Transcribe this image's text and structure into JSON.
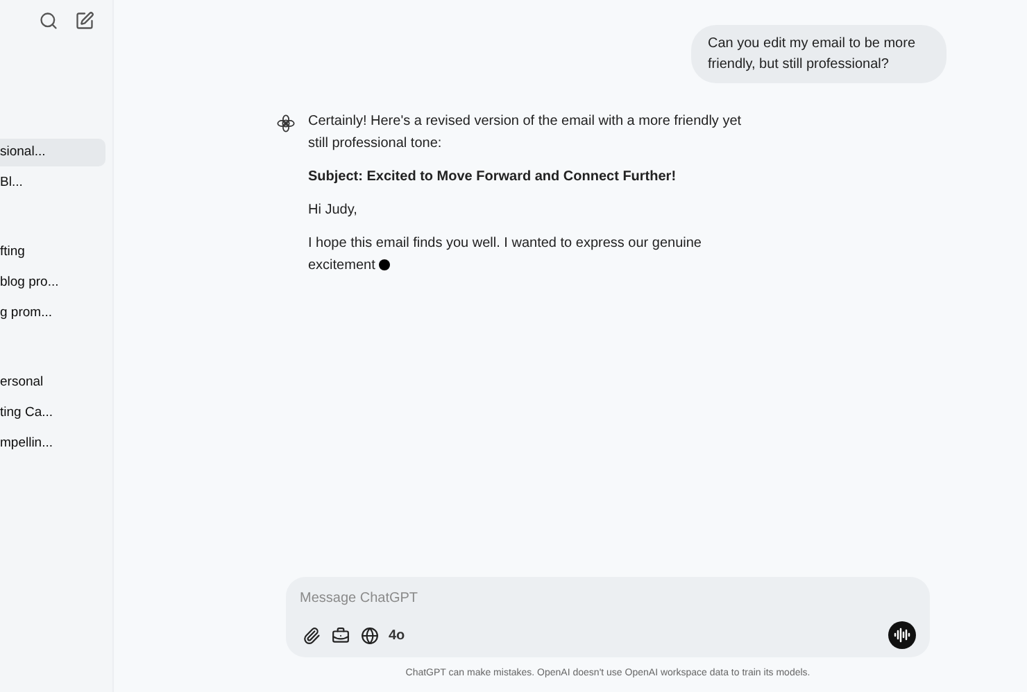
{
  "sidebar": {
    "items": [
      {
        "label": "sional...",
        "selected": true
      },
      {
        "label": "Bl...",
        "selected": false
      },
      {
        "label": "fting",
        "selected": false
      },
      {
        "label": "blog pro...",
        "selected": false
      },
      {
        "label": "g prom...",
        "selected": false
      },
      {
        "label": "ersonal",
        "selected": false
      },
      {
        "label": "ting Ca...",
        "selected": false
      },
      {
        "label": "mpellin...",
        "selected": false
      }
    ]
  },
  "user_message": "Can you edit my email to be more friendly, but still professional?",
  "assistant_message": {
    "paragraphs": [
      {
        "kind": "text",
        "text": "Certainly! Here's a revised version of the email with a more friendly yet still professional tone:"
      },
      {
        "kind": "bold",
        "text": "Subject: Excited to Move Forward and Connect Further!"
      },
      {
        "kind": "text",
        "text": "Hi Judy,"
      },
      {
        "kind": "streaming",
        "text": "I hope this email finds you well. I wanted to express our genuine excitement"
      }
    ]
  },
  "composer": {
    "placeholder": "Message ChatGPT",
    "model": "4o"
  },
  "footer": "ChatGPT can make mistakes. OpenAI doesn't use OpenAI workspace data to train its models."
}
